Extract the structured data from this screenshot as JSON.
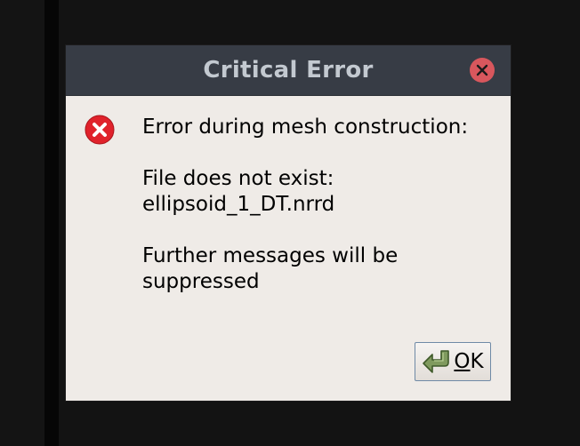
{
  "dialog": {
    "title": "Critical Error",
    "message": {
      "line1": "Error during mesh construction:",
      "line2": "File does not exist:",
      "line3": "ellipsoid_1_DT.nrrd",
      "line4": "Further messages will be",
      "line5": "suppressed"
    },
    "ok_button": {
      "mnemonic": "O",
      "rest": "K"
    },
    "icons": {
      "dialog_icon": "error-icon",
      "close": "close-icon",
      "ok": "return-arrow-icon"
    }
  },
  "colors": {
    "titlebar": "#373c45",
    "title_text": "#c3c9d0",
    "close_button": "#d8575d",
    "dialog_body": "#efebe7",
    "error_icon": "#e0222b"
  }
}
